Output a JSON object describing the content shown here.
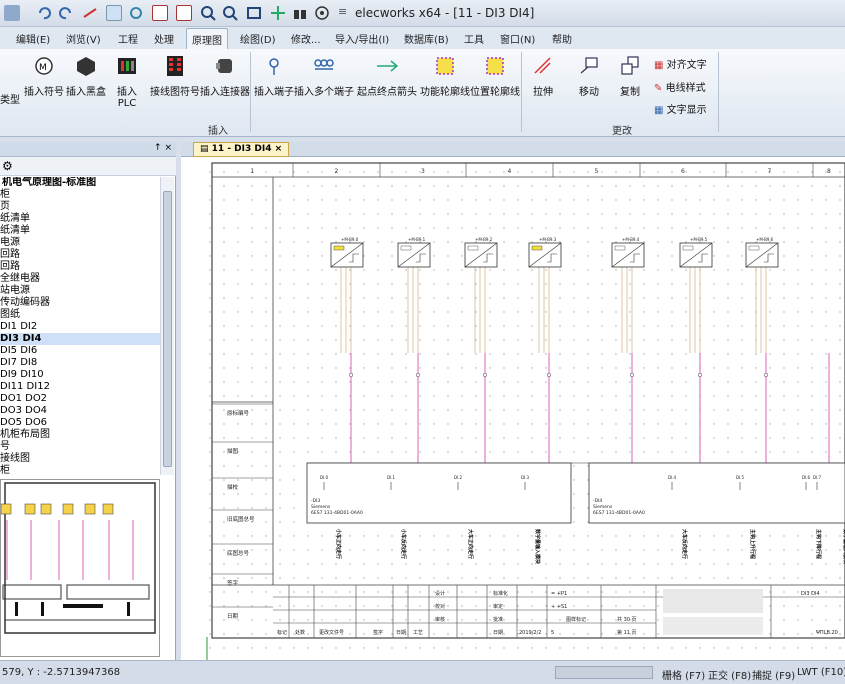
{
  "app": {
    "title": "elecworks x64 - [11 - DI3 DI4]",
    "caption_sep": "≡"
  },
  "menu": {
    "tabs": [
      "编辑(E)",
      "浏览(V)",
      "工程",
      "处理",
      "原理图",
      "绘图(D)",
      "修改...",
      "导入/导出(I)",
      "数据库(B)",
      "工具",
      "窗口(N)",
      "帮助"
    ],
    "active": "原理图"
  },
  "ribbon": {
    "insert": {
      "type_label": "类型",
      "symbol": "插入符号",
      "blackbox": "插入黑盒",
      "plc_1": "插入",
      "plc_2": "PLC",
      "wiring_symbol": "接线图符号",
      "connector": "插入连接器",
      "terminal": "插入端子",
      "multi_terminal": "插入多个端子",
      "origin_dest": "起点终点箭头",
      "func_outline": "功能轮廓线",
      "loc_outline": "位置轮廓线",
      "group": "插入"
    },
    "modify": {
      "stretch": "拉伸",
      "move": "移动",
      "copy": "复制",
      "align_text": "对齐文字",
      "wire_style": "电线样式",
      "text_display": "文字显示",
      "group": "更改"
    }
  },
  "left_panel": {
    "pin": "↑ ×",
    "tree": [
      "机电气原理图-标准图",
      "柜",
      "页",
      "纸清单",
      "纸清单",
      "电源",
      "回路",
      "回路",
      "全继电器",
      "站电源",
      "传动编码器",
      "图纸",
      "DI1 DI2",
      "DI3 DI4",
      "DI5 DI6",
      "DI7 DI8",
      "DI9 DI10",
      "DI11 DI12",
      "DO1 DO2",
      "DO3 DO4",
      "DO5 DO6",
      "机柜布局图",
      "号",
      "接线图",
      "柜"
    ],
    "selected": 13
  },
  "doc": {
    "tab": "11 - DI3 DI4",
    "columns": [
      "1",
      "2",
      "3",
      "4",
      "5",
      "6",
      "7",
      "8"
    ],
    "components": [
      "+M-B9.0",
      "+M-B9.1",
      "+M-B9.2",
      "+M-B9.3",
      "+M-B9.4",
      "+M-B9.5",
      "+M-B9.6"
    ],
    "plc_left": {
      "name": "-DI3",
      "maker": "Siemens",
      "ref": "6ES7 131-4BD01-0AA0",
      "ch": [
        "DI.0",
        "DI.1",
        "DI.2",
        "DI.3"
      ]
    },
    "plc_right": {
      "name": "-DI4",
      "maker": "Siemens",
      "ref": "6ES7 131-4BD01-0AA0",
      "ch": [
        "DI.4",
        "DI.5",
        "DI.6",
        "DI.7"
      ]
    },
    "side_labels": [
      "原标编号",
      "描图",
      "描校",
      "旧底图总号",
      "底图总号",
      "签字",
      "日期"
    ],
    "signals": [
      "小车正向走行",
      "小车反向走行",
      "大车正向走行",
      "数字量输入模块",
      "大车反向走行",
      "主钩上升行程",
      "主钩下降行程",
      "数字量输入模块"
    ],
    "titleblock": {
      "design": "设计",
      "check": "校对",
      "review": "审核",
      "std": "标准化",
      "audit": "审定",
      "approve": "批准",
      "date_h": "日期",
      "date": "2019/2/2",
      "marks": [
        "标记",
        "处数",
        "更改文件号",
        "签字",
        "日期",
        "工艺"
      ],
      "sheet_label": "图样标记",
      "sheet_total": "共  30  页",
      "sheet_no": "第  11  页",
      "eq1": "= +P1",
      "eq2": "+  +S1",
      "scale": "5",
      "sheet_name": "DI3 DI4",
      "ver": "ΨΠLB.20"
    }
  },
  "status": {
    "coords": "579, Y : -2.5713947368",
    "grid": "栅格 (F7)",
    "ortho": "正交 (F8)",
    "snap": "捕捉 (F9)",
    "lwt": "LWT (F10)"
  },
  "colors": {
    "wire": "#d63aa9",
    "wire_tan": "#c8a06a",
    "accent": "#3c6fb0"
  }
}
